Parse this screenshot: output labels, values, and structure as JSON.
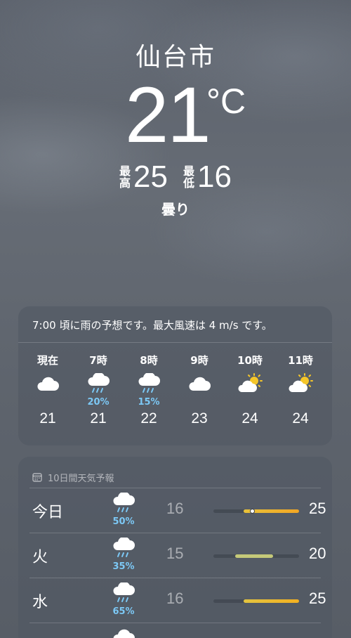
{
  "header": {
    "city": "仙台市",
    "temperature": "21",
    "degree": "°C",
    "high_label_1": "最",
    "high_label_2": "高",
    "high": "25",
    "low_label_1": "最",
    "low_label_2": "低",
    "low": "16",
    "condition": "曇り"
  },
  "hourly": {
    "summary": "7:00 頃に雨の予想です。最大風速は 4 m/s です。",
    "items": [
      {
        "time": "現在",
        "icon": "cloud-icon",
        "precip": "",
        "temp": "21"
      },
      {
        "time": "7時",
        "icon": "cloud-rain-icon",
        "precip": "20%",
        "temp": "21"
      },
      {
        "time": "8時",
        "icon": "cloud-rain-icon",
        "precip": "15%",
        "temp": "22"
      },
      {
        "time": "9時",
        "icon": "cloud-icon",
        "precip": "",
        "temp": "23"
      },
      {
        "time": "10時",
        "icon": "partly-sunny-icon",
        "precip": "",
        "temp": "24"
      },
      {
        "time": "11時",
        "icon": "partly-sunny-icon",
        "precip": "",
        "temp": "24"
      }
    ]
  },
  "daily": {
    "title": "10日間天気予報",
    "icon": "calendar-icon",
    "rows": [
      {
        "day": "今日",
        "icon": "cloud-rain-icon",
        "precip": "50%",
        "low": "16",
        "high": "25",
        "range_start": 0.35,
        "range_end": 1.0,
        "current": 0.45
      },
      {
        "day": "火",
        "icon": "cloud-rain-icon",
        "precip": "35%",
        "low": "15",
        "high": "20",
        "range_start": 0.25,
        "range_end": 0.7
      },
      {
        "day": "水",
        "icon": "cloud-rain-icon",
        "precip": "65%",
        "low": "16",
        "high": "25",
        "range_start": 0.35,
        "range_end": 1.0
      }
    ]
  },
  "colors": {
    "precip": "#7cc8f5",
    "bar_today": "#f0b82a",
    "bar_cool": "#c5c979",
    "bar_warm": "#f0c030"
  }
}
